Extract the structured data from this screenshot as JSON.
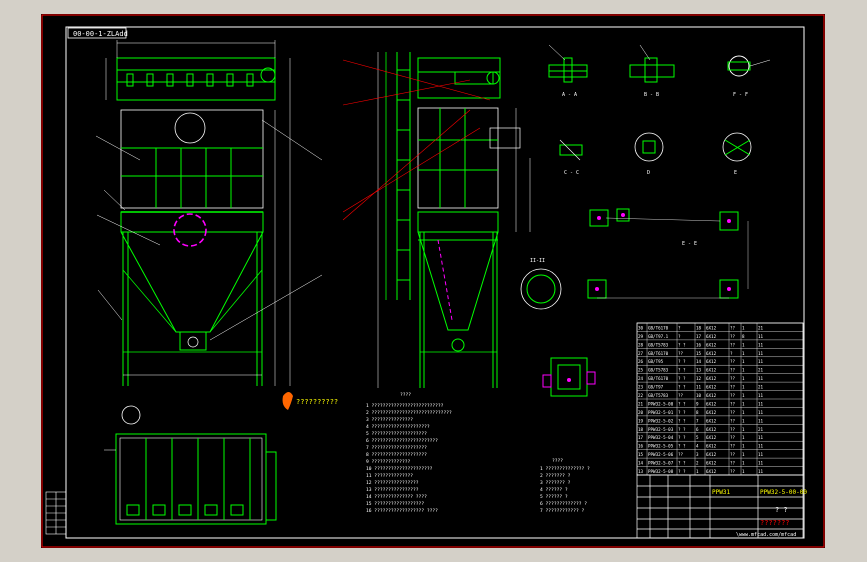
{
  "drawing": {
    "title_code": "00-00-1-ZLAdd",
    "logo_text": "??????????",
    "product_code": "PPW32-5-00-00",
    "product_code_short": "PPW31",
    "sheet_name": "? ?",
    "sheet_sub": "???????",
    "watermark_url": "\\www.mfcad.com/mfcad"
  },
  "views": {
    "section_aa": "A - A",
    "section_bb": "B - B",
    "section_ff": "F - F",
    "section_cc": "C - C",
    "detail_d": "D",
    "detail_e": "E",
    "section_ee": "E - E",
    "section_ll": "II-II"
  },
  "notes": {
    "main_title": "????",
    "items": [
      "1 ??????????????????????????",
      "2 ?????????????????????????????",
      "3 ???????????????",
      "4 ?????????????????????",
      "5 ????????????????????",
      "6 ????????????????????????",
      "7 ????????????????????",
      "8 ????????????????????",
      "9 ??????????????",
      "10 ?????????????????????",
      "11 ??????????????",
      "12 ????????????????",
      "13 ????????????????",
      "14 ?????????????? ????",
      "15 ??????????????????",
      "16 ?????????????????? ????"
    ],
    "sub_title": "????",
    "sub_items": [
      "1 ?????????????? ?",
      "2 ??????? ?",
      "3 ??????? ?",
      "4 ?????? ?",
      "5 ?????? ?",
      "6 ????????????? ?",
      "7 ???????????? ?"
    ]
  },
  "bom": {
    "rows": [
      [
        "30",
        "GB/T6170",
        "?",
        "18",
        "6X12",
        "??",
        "1",
        "21"
      ],
      [
        "29",
        "GB/T97.1",
        "?",
        "17",
        "6X12",
        "??",
        "8",
        "11"
      ],
      [
        "28",
        "GB/T5783",
        "? ?",
        "16",
        "6X12",
        "??",
        "1",
        "11"
      ],
      [
        "27",
        "GB/T6170",
        "??",
        "15",
        "6X12",
        "?",
        "1",
        "11"
      ],
      [
        "26",
        "GB/T95",
        "? ?",
        "14",
        "6X12",
        "??",
        "1",
        "11"
      ],
      [
        "25",
        "GB/T5783",
        "? ?",
        "13",
        "6X12",
        "??",
        "1",
        "21"
      ],
      [
        "24",
        "GB/T6170",
        "? ?",
        "12",
        "6X12",
        "??",
        "1",
        "11"
      ],
      [
        "23",
        "GB/T97",
        "? ?",
        "11",
        "6X12",
        "??",
        "1",
        "21"
      ],
      [
        "22",
        "GB/T5783",
        "??",
        "10",
        "6X12",
        "??",
        "1",
        "11"
      ],
      [
        "21",
        "PPW32-5-00",
        "? ?",
        "9",
        "6X12",
        "??",
        "1",
        "11"
      ],
      [
        "20",
        "PPW32-5-01",
        "? ?",
        "8",
        "6X12",
        "??",
        "1",
        "11"
      ],
      [
        "19",
        "PPW32-5-02",
        "? ?",
        "7",
        "6X12",
        "??",
        "1",
        "11"
      ],
      [
        "18",
        "PPW32-5-03",
        "? ?",
        "6",
        "6X12",
        "??",
        "1",
        "21"
      ],
      [
        "17",
        "PPW32-5-04",
        "? ?",
        "5",
        "6X12",
        "??",
        "1",
        "11"
      ],
      [
        "16",
        "PPW32-5-05",
        "? ?",
        "4",
        "6X12",
        "??",
        "1",
        "11"
      ],
      [
        "15",
        "PPW32-5-06",
        "??",
        "3",
        "6X12",
        "??",
        "1",
        "11"
      ],
      [
        "14",
        "PPW32-5-07",
        "? ?",
        "2",
        "6X12",
        "??",
        "1",
        "11"
      ],
      [
        "13",
        "PPW32-5-08",
        "? ?",
        "1",
        "6X12",
        "??",
        "1",
        "11"
      ]
    ]
  },
  "colors": {
    "frame_bg": "#000000",
    "line": "#00ff00",
    "text": "#ffffff",
    "highlight": "#ff00ff",
    "accent": "#ffff00",
    "dim": "#00ffff",
    "callout": "#ff0000"
  }
}
